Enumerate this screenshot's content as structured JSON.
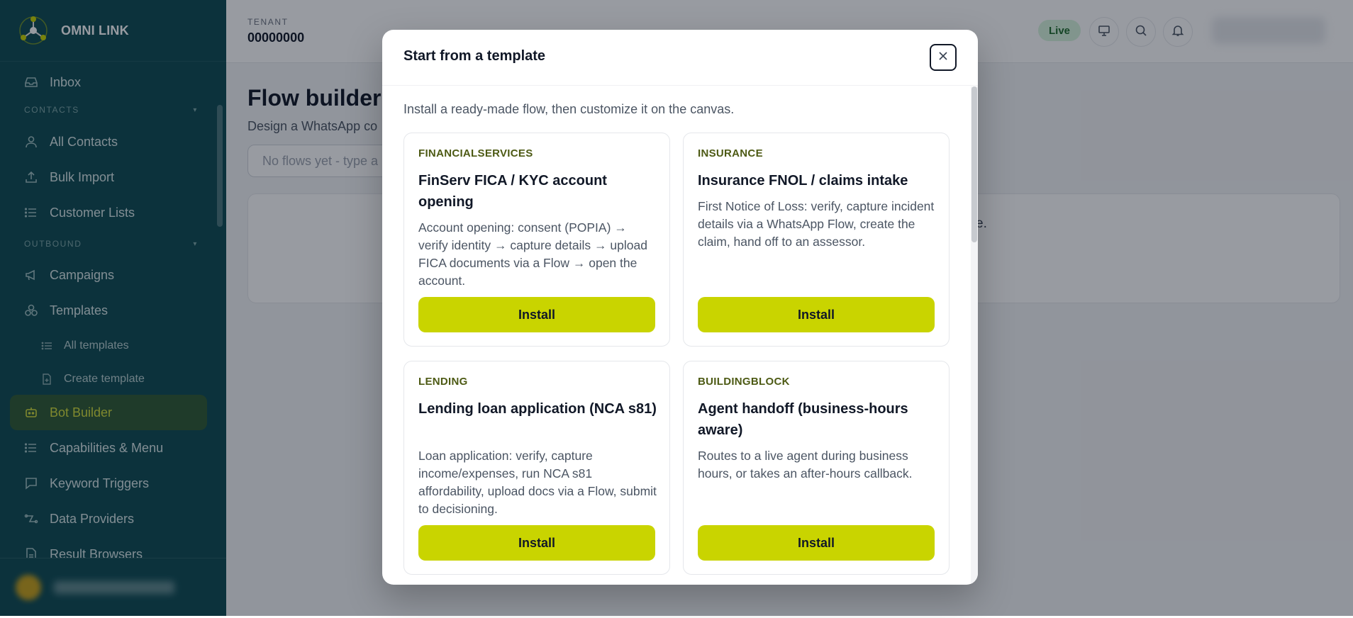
{
  "app": {
    "name": "OMNI LINK"
  },
  "sidebar": {
    "items": [
      {
        "label": "Inbox"
      },
      {
        "label": "All Contacts"
      },
      {
        "label": "Bulk Import"
      },
      {
        "label": "Customer Lists"
      },
      {
        "label": "Campaigns"
      },
      {
        "label": "Templates"
      },
      {
        "label": "All templates"
      },
      {
        "label": "Create template"
      },
      {
        "label": "Bot Builder"
      },
      {
        "label": "Capabilities & Menu"
      },
      {
        "label": "Keyword Triggers"
      },
      {
        "label": "Data Providers"
      },
      {
        "label": "Result Browsers"
      }
    ],
    "sections": [
      {
        "label": "CONTACTS"
      },
      {
        "label": "OUTBOUND"
      }
    ],
    "active_item": "Bot Builder"
  },
  "header": {
    "tenant_label": "TENANT",
    "tenant_value": "00000000",
    "status_badge": "Live"
  },
  "page": {
    "title": "Flow builder",
    "subtitle": "Design a WhatsApp co",
    "flow_select_placeholder": "No flows yet - type a",
    "empty_text": "emplate."
  },
  "modal": {
    "title": "Start from a template",
    "intro": "Install a ready-made flow, then customize it on the canvas.",
    "templates": [
      {
        "category": "FINANCIALSERVICES",
        "title": "FinServ FICA / KYC account opening",
        "description": "Account opening: consent (POPIA) → verify identity → capture details → upload FICA documents via a Flow → open the account.",
        "button": "Install"
      },
      {
        "category": "INSURANCE",
        "title": "Insurance FNOL / claims intake",
        "description": "First Notice of Loss: verify, capture incident details via a WhatsApp Flow, create the claim, hand off to an assessor.",
        "button": "Install"
      },
      {
        "category": "LENDING",
        "title": "Lending loan application (NCA s81)",
        "description": "Loan application: verify, capture income/expenses, run NCA s81 affordability, upload docs via a Flow, submit to decisioning.",
        "button": "Install"
      },
      {
        "category": "BUILDINGBLOCK",
        "title": "Agent handoff (business-hours aware)",
        "description": "Routes to a live agent during business hours, or takes an after-hours callback.",
        "button": "Install"
      }
    ]
  },
  "colors": {
    "sidebar_bg": "#0e4b52",
    "accent": "#c9d400",
    "active_nav_bg": "#2f5a33",
    "category_text": "#4d5a14"
  }
}
